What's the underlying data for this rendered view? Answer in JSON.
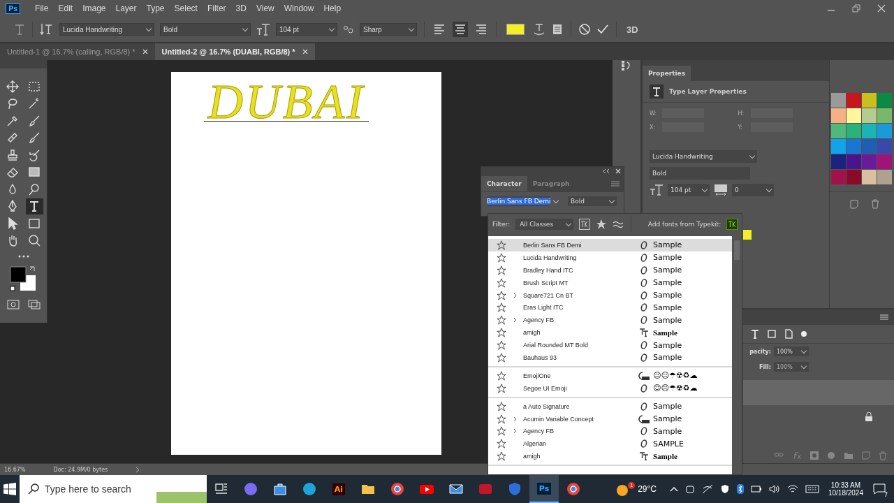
{
  "app_logo": "Ps",
  "menu_bar": [
    "File",
    "Edit",
    "Image",
    "Layer",
    "Type",
    "Select",
    "Filter",
    "3D",
    "View",
    "Window",
    "Help"
  ],
  "options_bar": {
    "font_family": "Lucida Handwriting",
    "font_style": "Bold",
    "font_size": "104 pt",
    "antialias": "Sharp",
    "align": [
      {
        "kind": "left",
        "selected": false
      },
      {
        "kind": "center",
        "selected": true
      },
      {
        "kind": "right",
        "selected": false
      }
    ],
    "label_3d": "3D"
  },
  "document_tabs": [
    {
      "label": "Untitled-1 @ 16.7% (calling, RGB/8) *",
      "selected": false
    },
    {
      "label": "Untitled-2 @ 16.7% (DUABI, RGB/8) *",
      "selected": true
    }
  ],
  "tools": [
    {
      "kind": "move",
      "selected": false
    },
    {
      "kind": "marquee",
      "selected": false
    },
    {
      "kind": "lasso",
      "selected": false
    },
    {
      "kind": "wand",
      "selected": false
    },
    {
      "kind": "eyedropper",
      "selected": false
    },
    {
      "kind": "brush",
      "selected": false
    },
    {
      "kind": "bandage",
      "selected": false
    },
    {
      "kind": "brush",
      "selected": false
    },
    {
      "kind": "stamp",
      "selected": false
    },
    {
      "kind": "history",
      "selected": false
    },
    {
      "kind": "eraser",
      "selected": false
    },
    {
      "kind": "gradient",
      "selected": false
    },
    {
      "kind": "blur",
      "selected": false
    },
    {
      "kind": "dodge",
      "selected": false
    },
    {
      "kind": "pen",
      "selected": false
    },
    {
      "kind": "type",
      "selected": true
    },
    {
      "kind": "arrow",
      "selected": false
    },
    {
      "kind": "rectangle",
      "selected": false
    },
    {
      "kind": "hand",
      "selected": false
    },
    {
      "kind": "zoom",
      "selected": false
    }
  ],
  "canvas": {
    "text": "DUBAI"
  },
  "character_panel": {
    "tabs": [
      {
        "label": "Character",
        "selected": true
      },
      {
        "label": "Paragraph",
        "selected": false
      }
    ],
    "font_field": "Berlin Sans FB Demi",
    "style_field": "Bold"
  },
  "font_menu": {
    "filter_label": "Filter:",
    "filter_value": "All Classes",
    "typekit_label": "Add fonts from Typekit:",
    "groups": [
      [
        {
          "name": "Berlin Sans FB Demi",
          "kind": "opentype",
          "sample": "Sample",
          "expandable": false,
          "selected": true
        },
        {
          "name": "Lucida Handwriting",
          "kind": "opentype",
          "sample": "Sample",
          "expandable": false,
          "selected": false
        },
        {
          "name": "Bradley Hand ITC",
          "kind": "opentype",
          "sample": "Sample",
          "expandable": false,
          "selected": false
        },
        {
          "name": "Brush Script MT",
          "kind": "opentype",
          "sample": "Sample",
          "expandable": false,
          "selected": false
        },
        {
          "name": "Square721 Cn BT",
          "kind": "opentype",
          "sample": "Sample",
          "expandable": true,
          "selected": false
        },
        {
          "name": "Eras Light ITC",
          "kind": "opentype",
          "sample": "Sample",
          "expandable": false,
          "selected": false
        },
        {
          "name": "Agency FB",
          "kind": "opentype",
          "sample": "Sample",
          "expandable": true,
          "selected": false
        },
        {
          "name": "amigh",
          "kind": "truetype",
          "sample": "Sample",
          "expandable": false,
          "selected": false
        },
        {
          "name": "Arial Rounded MT Bold",
          "kind": "opentype",
          "sample": "Sample",
          "expandable": false,
          "selected": false
        },
        {
          "name": "Bauhaus 93",
          "kind": "opentype",
          "sample": "Sample",
          "expandable": false,
          "selected": false
        }
      ],
      [
        {
          "name": "EmojiOne",
          "kind": "svg",
          "sample": "☺☹☂☢♻☁",
          "expandable": false,
          "selected": false
        },
        {
          "name": "Segoe UI Emoji",
          "kind": "opentype",
          "sample": "☺☹☂☢♻☁",
          "expandable": false,
          "selected": false
        }
      ],
      [
        {
          "name": "a Auto Signature",
          "kind": "opentype",
          "sample": "Sample",
          "expandable": false,
          "selected": false
        },
        {
          "name": "Acumin Variable Concept",
          "kind": "svg",
          "sample": "Sample",
          "expandable": true,
          "selected": false
        },
        {
          "name": "Agency FB",
          "kind": "opentype",
          "sample": "Sample",
          "expandable": true,
          "selected": false
        },
        {
          "name": "Algerian",
          "kind": "opentype",
          "sample": "SAMPLE",
          "expandable": false,
          "selected": false
        },
        {
          "name": "amigh",
          "kind": "truetype",
          "sample": "Sample",
          "expandable": false,
          "selected": false
        }
      ]
    ]
  },
  "properties_panel": {
    "tab": "Properties",
    "header": "Type Layer Properties",
    "fields": [
      {
        "label": "W:"
      },
      {
        "label": "H:"
      },
      {
        "label": "X:"
      },
      {
        "label": "Y:"
      }
    ],
    "font_family": "Lucida Handwriting",
    "font_style": "Bold",
    "font_size": "104 pt",
    "tracking": "0"
  },
  "swatches": [
    {
      "color": "#9a9a9a"
    },
    {
      "color": "#c8161d"
    },
    {
      "color": "#c9c020"
    },
    {
      "color": "#0a8a43"
    },
    {
      "color": "#f4b183"
    },
    {
      "color": "#fff59d"
    },
    {
      "color": "#b5cc8e"
    },
    {
      "color": "#78b86a"
    },
    {
      "color": "#4fb87a"
    },
    {
      "color": "#2bb27a"
    },
    {
      "color": "#1bb3b3"
    },
    {
      "color": "#1a9ad6"
    },
    {
      "color": "#12a4e8"
    },
    {
      "color": "#1976d2"
    },
    {
      "color": "#1e5fb4"
    },
    {
      "color": "#3949ab"
    },
    {
      "color": "#1a237e"
    },
    {
      "color": "#4a148c"
    },
    {
      "color": "#6a1b9a"
    },
    {
      "color": "#a0147a"
    },
    {
      "color": "#a0134a"
    },
    {
      "color": "#8b0a2a"
    },
    {
      "color": "#d8c0a0"
    },
    {
      "color": "#b0a090"
    }
  ],
  "layers_panel": {
    "opacity_label": "pacity:",
    "opacity": "100%",
    "fill_label": "Fill:",
    "fill": "100%"
  },
  "status_bar": {
    "zoom": "16.67%",
    "doc": "Doc: 24.9M/0 bytes"
  },
  "taskbar": {
    "search_placeholder": "Type here to search",
    "apps": [
      {
        "kind": "taskview",
        "selected": false
      },
      {
        "kind": "copilot",
        "selected": false
      },
      {
        "kind": "store",
        "selected": false
      },
      {
        "kind": "edge",
        "selected": false
      },
      {
        "kind": "illustrator",
        "label": "Ai",
        "selected": false
      },
      {
        "kind": "folder",
        "selected": false
      },
      {
        "kind": "chrome",
        "selected": false
      },
      {
        "kind": "youtube",
        "selected": false
      },
      {
        "kind": "mail",
        "selected": false
      },
      {
        "kind": "recorder",
        "selected": false
      },
      {
        "kind": "shield",
        "selected": false
      },
      {
        "kind": "photoshop",
        "label": "Ps",
        "selected": true
      },
      {
        "kind": "chrome",
        "selected": false
      }
    ],
    "weather_badge": "1",
    "temperature": "29°C",
    "time": "10:33 AM",
    "date": "10/18/2024",
    "notifications": "7"
  }
}
